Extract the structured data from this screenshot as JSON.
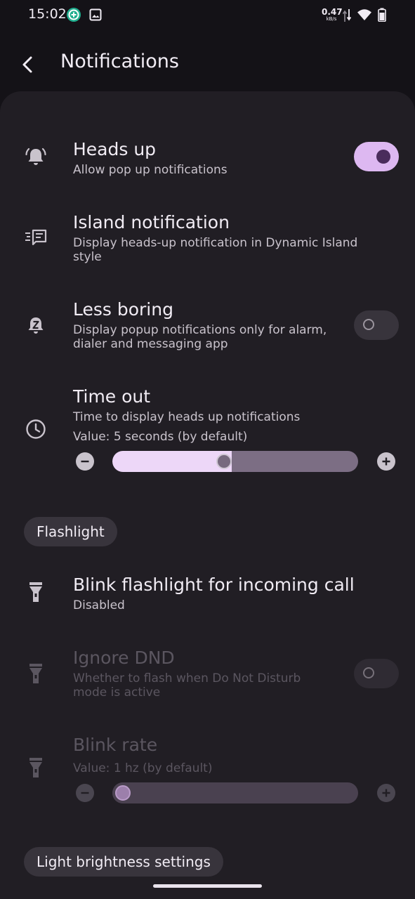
{
  "status_bar": {
    "time": "15:02",
    "net_speed_value": "0.47",
    "net_speed_unit": "kB/s",
    "icons": [
      "app-notification-icon",
      "image-icon",
      "data-arrows-icon",
      "wifi-icon",
      "battery-icon"
    ]
  },
  "app_bar": {
    "title": "Notifications",
    "back_icon": "back-arrow-icon"
  },
  "settings": {
    "heads_up": {
      "title": "Heads up",
      "summary": "Allow pop up notifications",
      "enabled": true,
      "icon": "bell-ringing-icon"
    },
    "island": {
      "title": "Island notification",
      "summary": "Display heads-up notification in Dynamic Island style",
      "icon": "notes-list-icon"
    },
    "less_boring": {
      "title": "Less boring",
      "summary": "Display popup notifications only for alarm, dialer and messaging app",
      "enabled": false,
      "icon": "bell-snooze-icon"
    },
    "time_out": {
      "title": "Time out",
      "summary": "Time to display heads up notifications",
      "value": "Value: 5 seconds (by default)",
      "level": 0.45,
      "icon": "clock-icon"
    }
  },
  "flashlight": {
    "header": "Flashlight",
    "blink_call": {
      "title": "Blink flashlight for incoming call",
      "summary": "Disabled",
      "icon": "flashlight-icon"
    },
    "ignore_dnd": {
      "title": "Ignore DND",
      "summary": "Whether to flash when Do Not Disturb mode is active",
      "enabled": false,
      "icon": "flashlight-icon"
    },
    "blink_rate": {
      "title": "Blink rate",
      "value": "Value: 1 hz (by default)",
      "level": 0.0,
      "icon": "flashlight-icon"
    }
  },
  "light_brightness": {
    "header": "Light brightness settings"
  },
  "colors": {
    "accent": "#DDB8F1",
    "surface": "#211E24",
    "background": "#141217",
    "chip": "#38343C"
  }
}
